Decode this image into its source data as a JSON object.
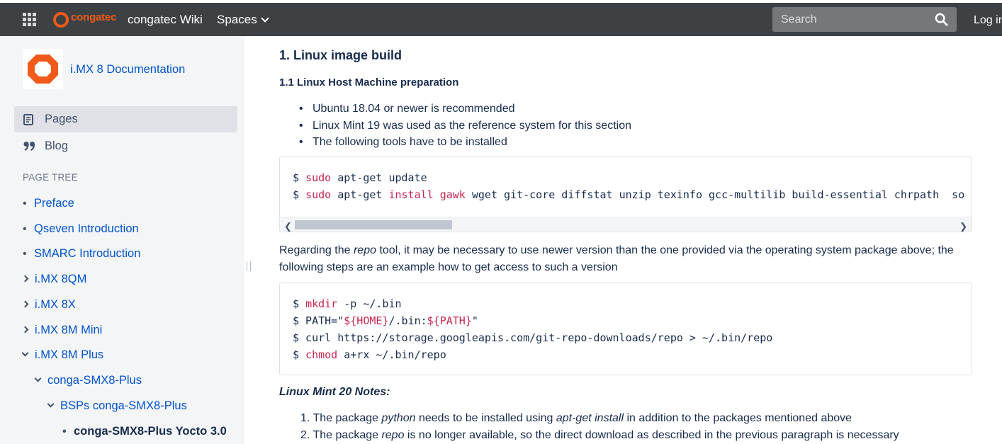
{
  "topbar": {
    "logo_text": "congatec",
    "site_title": "congatec Wiki",
    "spaces_label": "Spaces",
    "search_placeholder": "Search",
    "login_label": "Log in",
    "brand_color": "#f05a1a",
    "bar_color": "#3d4143"
  },
  "sidebar": {
    "space_name": "i.MX 8 Documentation",
    "nav": [
      {
        "label": "Pages",
        "icon": "document-icon",
        "selected": true
      },
      {
        "label": "Blog",
        "icon": "quote-icon",
        "selected": false
      }
    ],
    "tree_heading": "PAGE TREE",
    "tree": [
      {
        "label": "Preface",
        "marker": "bullet"
      },
      {
        "label": "Qseven Introduction",
        "marker": "bullet"
      },
      {
        "label": "SMARC Introduction",
        "marker": "bullet"
      },
      {
        "label": "i.MX 8QM",
        "marker": "chevron-right"
      },
      {
        "label": "i.MX 8X",
        "marker": "chevron-right"
      },
      {
        "label": "i.MX 8M Mini",
        "marker": "chevron-right"
      },
      {
        "label": "i.MX 8M Plus",
        "marker": "chevron-down"
      },
      {
        "label": "conga-SMX8-Plus",
        "marker": "chevron-down"
      },
      {
        "label": "BSPs conga-SMX8-Plus",
        "marker": "chevron-down"
      },
      {
        "label": "conga-SMX8-Plus Yocto 3.0",
        "marker": "bullet",
        "current": true
      }
    ]
  },
  "main": {
    "heading": "1. Linux image build",
    "subheading": "1.1 Linux Host Machine preparation",
    "bullets": [
      "Ubuntu 18.04 or newer is recommended",
      "Linux Mint 19 was used as the reference system for this section",
      "The following tools have to be installed"
    ],
    "code1": {
      "line1": {
        "prompt": "$ ",
        "kw": "sudo",
        "rest": " apt-get update"
      },
      "line2": {
        "prompt": "$ ",
        "kw1": "sudo",
        "mid1": " apt-get ",
        "kw2": "install",
        "mid2": " ",
        "kw3": "gawk",
        "rest": " wget git-core diffstat unzip texinfo gcc-multilib build-essential chrpath  so"
      }
    },
    "paragraph": {
      "before": "Regarding the ",
      "em": "repo",
      "after": " tool, it may be necessary to use newer version than the one provided via the operating system package above; the following steps are an example how to get access to such a version"
    },
    "code2": {
      "line1": {
        "prompt": "$ ",
        "kw": "mkdir",
        "rest": " -p ~/.bin"
      },
      "line2": {
        "pre": "$ PATH=\"",
        "kw1": "${HOME}",
        "mid": "/.bin:",
        "kw2": "${PATH}",
        "post": "\""
      },
      "line3": {
        "text": "$ curl https://storage.googleapis.com/git-repo-downloads/repo > ~/.bin/repo"
      },
      "line4": {
        "prompt": "$ ",
        "kw": "chmod",
        "rest": " a+rx ~/.bin/repo"
      }
    },
    "notes_heading": "Linux Mint 20 Notes:",
    "notes": [
      {
        "num": "1. ",
        "a": "The package ",
        "em1": "python",
        "b": " needs to be installed using ",
        "em2": "apt-get install",
        "c": " in addition to the packages mentioned above"
      },
      {
        "num": "2. ",
        "a": "The package ",
        "em1": "repo",
        "b": " is no longer available, so the direct download as described in the previous paragraph is necessary"
      }
    ]
  }
}
